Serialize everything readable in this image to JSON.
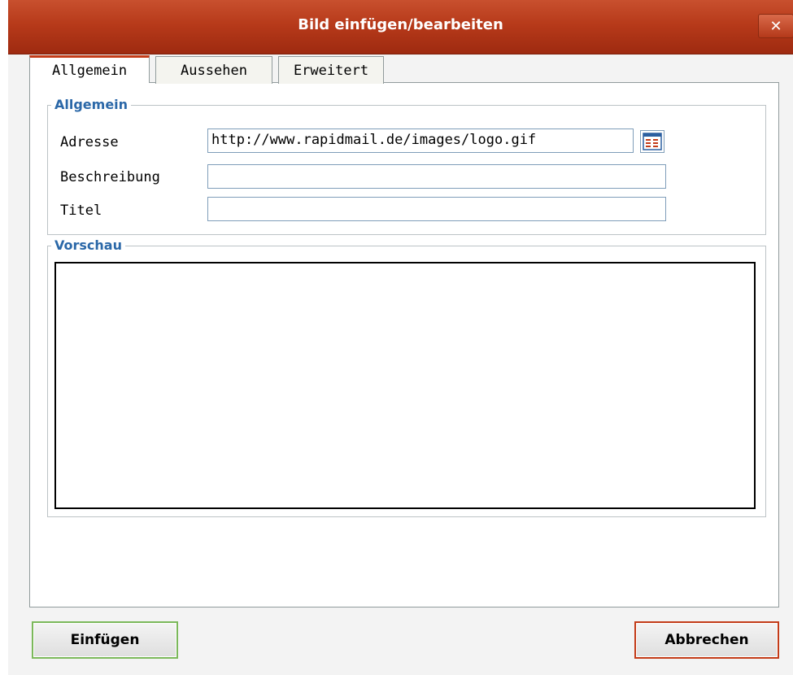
{
  "dialog": {
    "title": "Bild einfügen/bearbeiten",
    "close_label": "✕"
  },
  "tabs": [
    {
      "label": "Allgemein",
      "active": true
    },
    {
      "label": "Aussehen",
      "active": false
    },
    {
      "label": "Erweitert",
      "active": false
    }
  ],
  "general": {
    "legend": "Allgemein",
    "address_label": "Adresse",
    "address_value": "http://www.rapidmail.de/images/logo.gif",
    "description_label": "Beschreibung",
    "description_value": "",
    "title_label": "Titel",
    "title_value": ""
  },
  "preview": {
    "legend": "Vorschau"
  },
  "buttons": {
    "insert": "Einfügen",
    "cancel": "Abbrechen"
  },
  "colors": {
    "titlebar": "#b73a1a",
    "legend": "#2b68a8",
    "insert_border": "#7bb85a",
    "cancel_border": "#c33b18"
  },
  "icons": {
    "browse": "browse-icon"
  }
}
